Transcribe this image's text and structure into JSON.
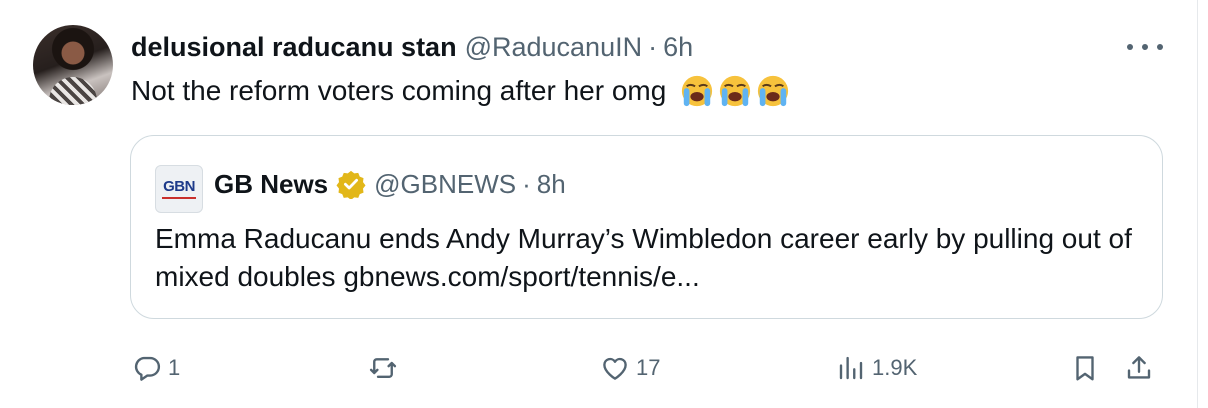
{
  "tweet": {
    "display_name": "delusional raducanu stan",
    "handle": "@RaducanuIN",
    "separator": "·",
    "time": "6h",
    "text": "Not the reform voters coming after her omg",
    "emoji": [
      "loudly-crying-face",
      "loudly-crying-face",
      "loudly-crying-face"
    ]
  },
  "quoted": {
    "logo_text": "GBN",
    "display_name": "GB News",
    "verified_badge": "gold-check-badge",
    "handle": "@GBNEWS",
    "separator": "·",
    "time": "8h",
    "text": "Emma Raducanu ends Andy Murray’s Wimbledon career early by pulling out of mixed doubles gbnews.com/sport/tennis/e..."
  },
  "actions": {
    "reply_count": "1",
    "repost_count": "",
    "like_count": "17",
    "views_count": "1.9K"
  },
  "colors": {
    "text_primary": "#0f1419",
    "text_secondary": "#536471",
    "border": "#cfd9de",
    "verified_gold": "#e2b719"
  }
}
